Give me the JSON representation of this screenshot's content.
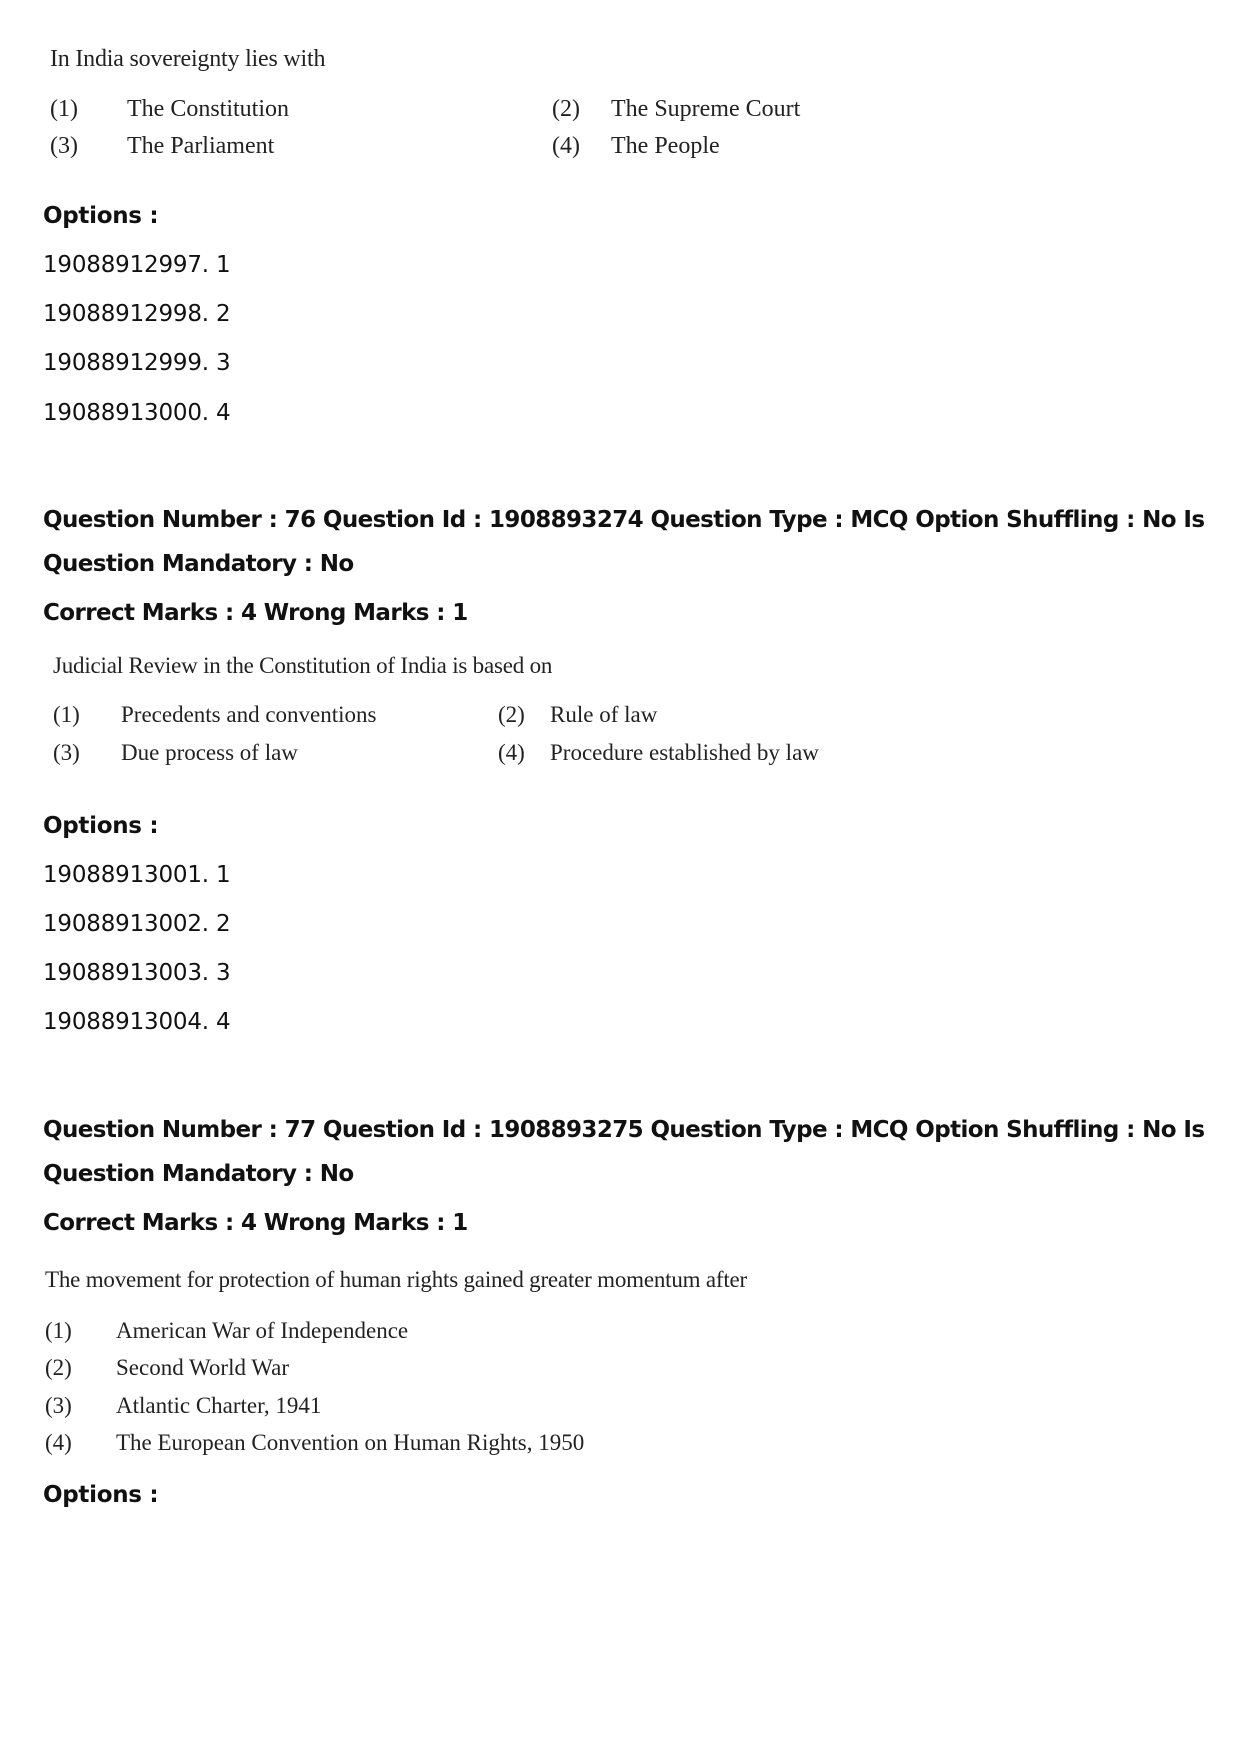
{
  "q75": {
    "stem": "In India sovereignty lies with",
    "choices": [
      {
        "num": "(1)",
        "text": "The Constitution"
      },
      {
        "num": "(2)",
        "text": "The Supreme Court"
      },
      {
        "num": "(3)",
        "text": "The Parliament"
      },
      {
        "num": "(4)",
        "text": "The People"
      }
    ],
    "options_label": "Options :",
    "options": [
      "19088912997. 1",
      "19088912998. 2",
      "19088912999. 3",
      "19088913000. 4"
    ]
  },
  "q76": {
    "meta_line1": "Question Number : 76 Question Id : 1908893274 Question Type : MCQ Option Shuffling : No Is",
    "meta_line2": "Question Mandatory : No",
    "marks": "Correct Marks : 4 Wrong Marks : 1",
    "stem": "Judicial Review in the Constitution of India is based on",
    "choices": [
      {
        "num": "(1)",
        "text": "Precedents and conventions"
      },
      {
        "num": "(2)",
        "text": "Rule of law"
      },
      {
        "num": "(3)",
        "text": "Due process of law"
      },
      {
        "num": "(4)",
        "text": "Procedure established by law"
      }
    ],
    "options_label": "Options :",
    "options": [
      "19088913001. 1",
      "19088913002. 2",
      "19088913003. 3",
      "19088913004. 4"
    ]
  },
  "q77": {
    "meta_line1": "Question Number : 77 Question Id : 1908893275 Question Type : MCQ Option Shuffling : No Is",
    "meta_line2": "Question Mandatory : No",
    "marks": "Correct Marks : 4 Wrong Marks : 1",
    "stem": "The movement for protection of human rights gained greater momentum after",
    "choices": [
      {
        "num": "(1)",
        "text": "American War of Independence"
      },
      {
        "num": "(2)",
        "text": "Second World War"
      },
      {
        "num": "(3)",
        "text": "Atlantic Charter, 1941"
      },
      {
        "num": "(4)",
        "text": "The European Convention on Human Rights, 1950"
      }
    ],
    "options_label": "Options :"
  }
}
